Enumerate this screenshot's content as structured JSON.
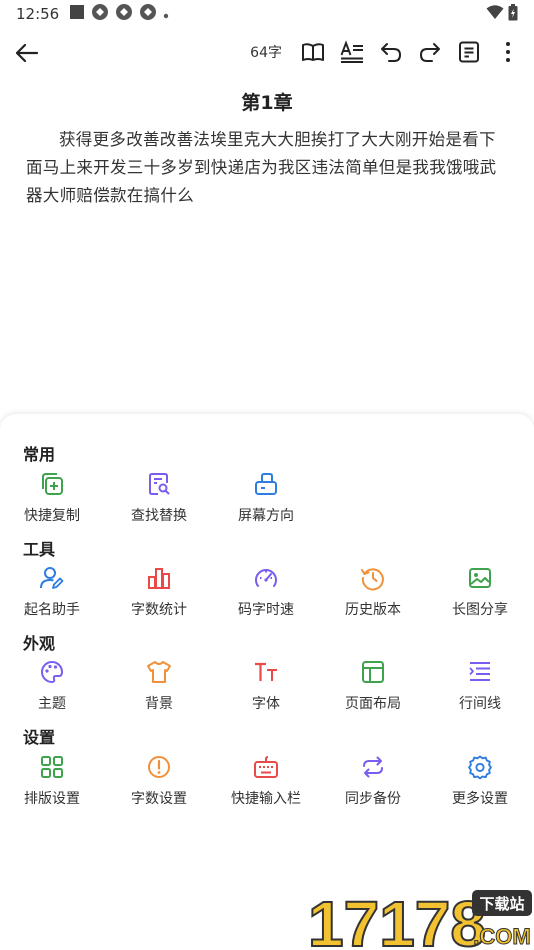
{
  "status_bar": {
    "time": "12:56"
  },
  "toolbar": {
    "word_count": "64字"
  },
  "editor": {
    "chapter_title": "第1章",
    "body": "获得更多改善改善法埃里克大大胆挨打了大大刚开始是看下面马上来开发三十多岁到快递店为我区违法简单但是我我饿哦武器大师赔偿款在搞什么"
  },
  "menu": {
    "sections": [
      {
        "title": "常用",
        "items": [
          {
            "label": "快捷复制",
            "icon": "copy-add-icon",
            "color": "#3fa34d"
          },
          {
            "label": "查找替换",
            "icon": "search-doc-icon",
            "color": "#7a5cf0"
          },
          {
            "label": "屏幕方向",
            "icon": "screen-rotate-icon",
            "color": "#2f7de1"
          }
        ]
      },
      {
        "title": "工具",
        "items": [
          {
            "label": "起名助手",
            "icon": "user-edit-icon",
            "color": "#2f7de1"
          },
          {
            "label": "字数统计",
            "icon": "bar-chart-icon",
            "color": "#e84a4a"
          },
          {
            "label": "码字时速",
            "icon": "speedometer-icon",
            "color": "#7a5cf0"
          },
          {
            "label": "历史版本",
            "icon": "history-icon",
            "color": "#f0913a"
          },
          {
            "label": "长图分享",
            "icon": "image-icon",
            "color": "#3fa34d"
          }
        ]
      },
      {
        "title": "外观",
        "items": [
          {
            "label": "主题",
            "icon": "palette-icon",
            "color": "#7a5cf0"
          },
          {
            "label": "背景",
            "icon": "shirt-icon",
            "color": "#f0913a"
          },
          {
            "label": "字体",
            "icon": "font-icon",
            "color": "#e84a4a"
          },
          {
            "label": "页面布局",
            "icon": "layout-icon",
            "color": "#3fa34d"
          },
          {
            "label": "行间线",
            "icon": "line-spacing-icon",
            "color": "#7a5cf0"
          }
        ]
      },
      {
        "title": "设置",
        "items": [
          {
            "label": "排版设置",
            "icon": "grid-icon",
            "color": "#3fa34d"
          },
          {
            "label": "字数设置",
            "icon": "alert-circle-icon",
            "color": "#f0913a"
          },
          {
            "label": "快捷输入栏",
            "icon": "keyboard-icon",
            "color": "#e84a4a"
          },
          {
            "label": "同步备份",
            "icon": "sync-icon",
            "color": "#7a5cf0"
          },
          {
            "label": "更多设置",
            "icon": "gear-icon",
            "color": "#2f7de1"
          }
        ]
      }
    ]
  },
  "watermark": {
    "logo_text": "17178",
    "badge": "下载站",
    "domain": ".COM"
  }
}
